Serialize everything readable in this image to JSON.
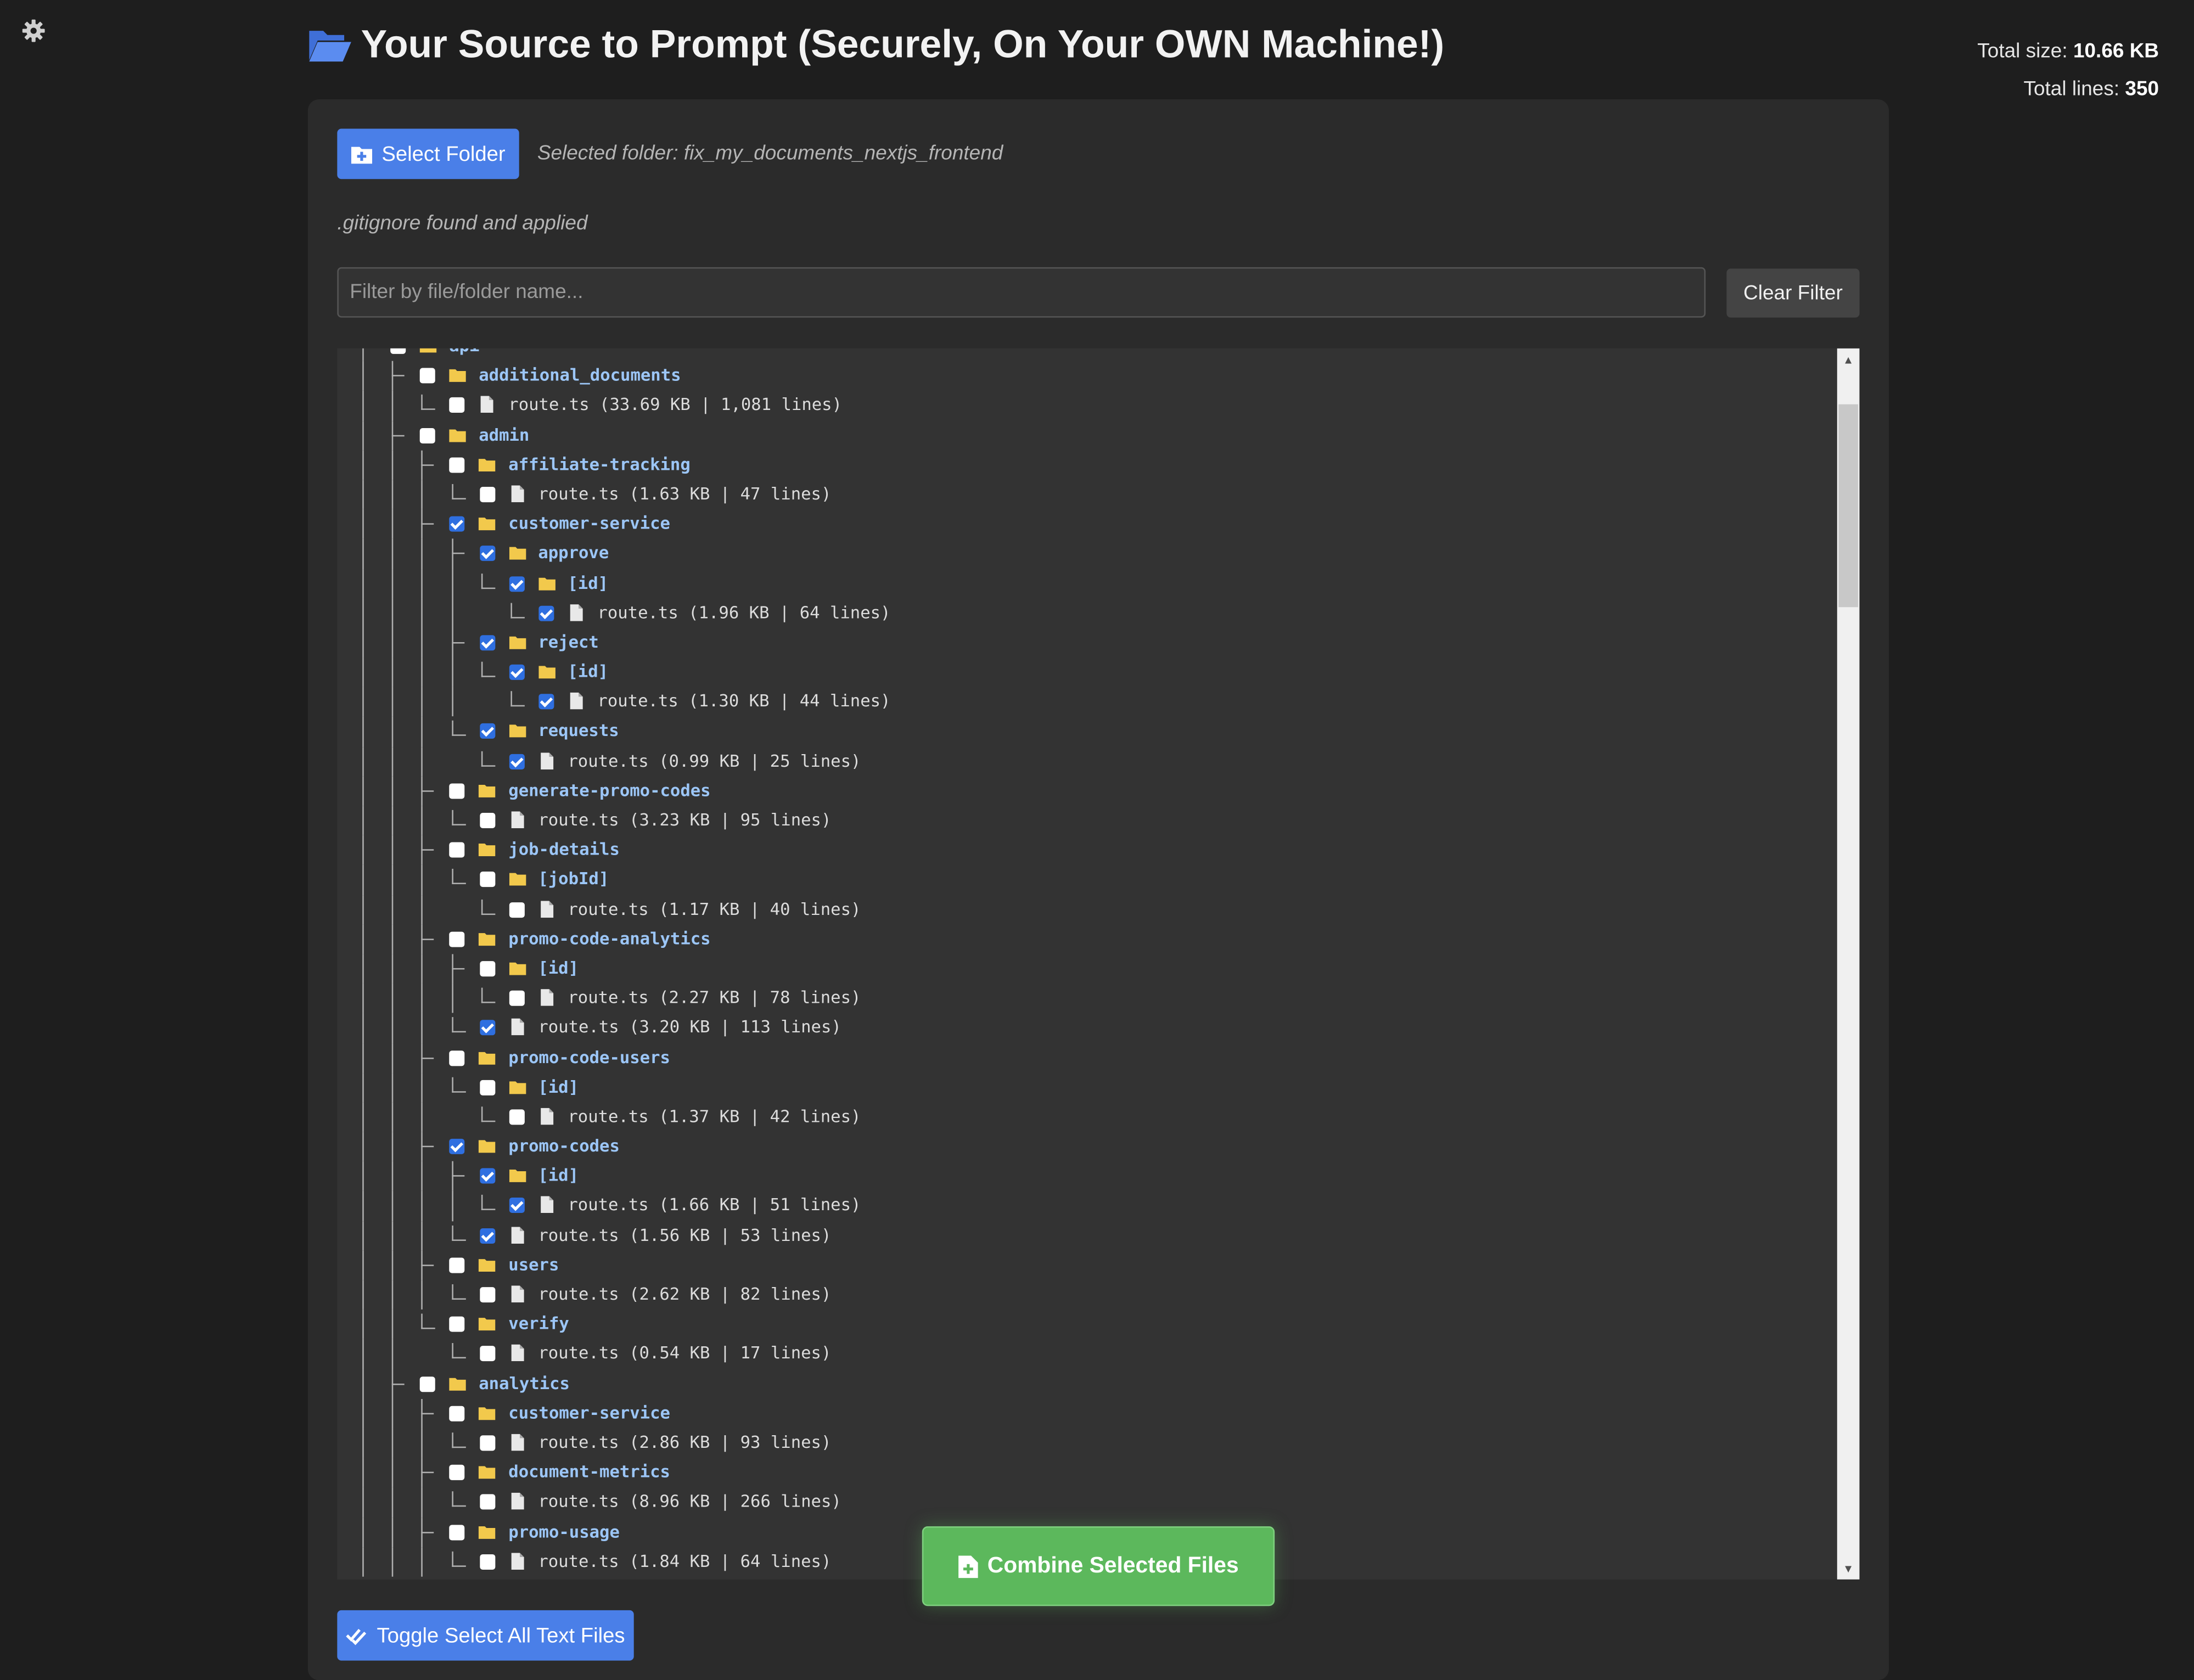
{
  "header": {
    "title": "Your Source to Prompt (Securely, On Your OWN Machine!)",
    "total_size_label": "Total size:",
    "total_size_value": "10.66 KB",
    "total_lines_label": "Total lines:",
    "total_lines_value": "350"
  },
  "toolbar": {
    "select_folder_label": "Select Folder",
    "selected_folder_text": "Selected folder: fix_my_documents_nextjs_frontend",
    "gitignore_text": ".gitignore found and applied",
    "filter_placeholder": "Filter by file/folder name...",
    "filter_value": "",
    "clear_filter_label": "Clear Filter"
  },
  "tree": {
    "rows": [
      {
        "depth": 1,
        "type": "folder",
        "name": "api",
        "checked": false,
        "last": false
      },
      {
        "depth": 2,
        "type": "folder",
        "name": "additional_documents",
        "checked": false,
        "last": false
      },
      {
        "depth": 3,
        "type": "file",
        "name": "route.ts (33.69 KB | 1,081 lines)",
        "checked": false,
        "last": true
      },
      {
        "depth": 2,
        "type": "folder",
        "name": "admin",
        "checked": false,
        "last": false
      },
      {
        "depth": 3,
        "type": "folder",
        "name": "affiliate-tracking",
        "checked": false,
        "last": false
      },
      {
        "depth": 4,
        "type": "file",
        "name": "route.ts (1.63 KB | 47 lines)",
        "checked": false,
        "last": true
      },
      {
        "depth": 3,
        "type": "folder",
        "name": "customer-service",
        "checked": true,
        "last": false
      },
      {
        "depth": 4,
        "type": "folder",
        "name": "approve",
        "checked": true,
        "last": false
      },
      {
        "depth": 5,
        "type": "folder",
        "name": "[id]",
        "checked": true,
        "last": true
      },
      {
        "depth": 6,
        "type": "file",
        "name": "route.ts (1.96 KB | 64 lines)",
        "checked": true,
        "last": true
      },
      {
        "depth": 4,
        "type": "folder",
        "name": "reject",
        "checked": true,
        "last": false
      },
      {
        "depth": 5,
        "type": "folder",
        "name": "[id]",
        "checked": true,
        "last": true
      },
      {
        "depth": 6,
        "type": "file",
        "name": "route.ts (1.30 KB | 44 lines)",
        "checked": true,
        "last": true
      },
      {
        "depth": 4,
        "type": "folder",
        "name": "requests",
        "checked": true,
        "last": true
      },
      {
        "depth": 5,
        "type": "file",
        "name": "route.ts (0.99 KB | 25 lines)",
        "checked": true,
        "last": true
      },
      {
        "depth": 3,
        "type": "folder",
        "name": "generate-promo-codes",
        "checked": false,
        "last": false
      },
      {
        "depth": 4,
        "type": "file",
        "name": "route.ts (3.23 KB | 95 lines)",
        "checked": false,
        "last": true
      },
      {
        "depth": 3,
        "type": "folder",
        "name": "job-details",
        "checked": false,
        "last": false
      },
      {
        "depth": 4,
        "type": "folder",
        "name": "[jobId]",
        "checked": false,
        "last": true
      },
      {
        "depth": 5,
        "type": "file",
        "name": "route.ts (1.17 KB | 40 lines)",
        "checked": false,
        "last": true
      },
      {
        "depth": 3,
        "type": "folder",
        "name": "promo-code-analytics",
        "checked": false,
        "last": false
      },
      {
        "depth": 4,
        "type": "folder",
        "name": "[id]",
        "checked": false,
        "last": false
      },
      {
        "depth": 5,
        "type": "file",
        "name": "route.ts (2.27 KB | 78 lines)",
        "checked": false,
        "last": true
      },
      {
        "depth": 4,
        "type": "file",
        "name": "route.ts (3.20 KB | 113 lines)",
        "checked": true,
        "last": true
      },
      {
        "depth": 3,
        "type": "folder",
        "name": "promo-code-users",
        "checked": false,
        "last": false
      },
      {
        "depth": 4,
        "type": "folder",
        "name": "[id]",
        "checked": false,
        "last": true
      },
      {
        "depth": 5,
        "type": "file",
        "name": "route.ts (1.37 KB | 42 lines)",
        "checked": false,
        "last": true
      },
      {
        "depth": 3,
        "type": "folder",
        "name": "promo-codes",
        "checked": true,
        "last": false
      },
      {
        "depth": 4,
        "type": "folder",
        "name": "[id]",
        "checked": true,
        "last": false
      },
      {
        "depth": 5,
        "type": "file",
        "name": "route.ts (1.66 KB | 51 lines)",
        "checked": true,
        "last": true
      },
      {
        "depth": 4,
        "type": "file",
        "name": "route.ts (1.56 KB | 53 lines)",
        "checked": true,
        "last": true
      },
      {
        "depth": 3,
        "type": "folder",
        "name": "users",
        "checked": false,
        "last": false
      },
      {
        "depth": 4,
        "type": "file",
        "name": "route.ts (2.62 KB | 82 lines)",
        "checked": false,
        "last": true
      },
      {
        "depth": 3,
        "type": "folder",
        "name": "verify",
        "checked": false,
        "last": true
      },
      {
        "depth": 4,
        "type": "file",
        "name": "route.ts (0.54 KB | 17 lines)",
        "checked": false,
        "last": true
      },
      {
        "depth": 2,
        "type": "folder",
        "name": "analytics",
        "checked": false,
        "last": false
      },
      {
        "depth": 3,
        "type": "folder",
        "name": "customer-service",
        "checked": false,
        "last": false
      },
      {
        "depth": 4,
        "type": "file",
        "name": "route.ts (2.86 KB | 93 lines)",
        "checked": false,
        "last": true
      },
      {
        "depth": 3,
        "type": "folder",
        "name": "document-metrics",
        "checked": false,
        "last": false
      },
      {
        "depth": 4,
        "type": "file",
        "name": "route.ts (8.96 KB | 266 lines)",
        "checked": false,
        "last": true
      },
      {
        "depth": 3,
        "type": "folder",
        "name": "promo-usage",
        "checked": false,
        "last": false
      },
      {
        "depth": 4,
        "type": "file",
        "name": "route.ts (1.84 KB | 64 lines)",
        "checked": false,
        "last": true
      }
    ]
  },
  "actions": {
    "toggle_select_label": "Toggle Select All Text Files",
    "combine_label": "Combine Selected Files"
  },
  "icons": {
    "settings": "gear-icon",
    "header": "folder-open-icon",
    "select_folder": "folder-plus-icon",
    "folder": "folder-icon",
    "file": "file-icon",
    "toggle": "check-double-icon",
    "combine": "file-plus-icon"
  },
  "colors": {
    "accent_blue": "#4a7fe8",
    "combine_green": "#5cb85c",
    "folder_yellow": "#f2c94c",
    "folder_label": "#9cc6f7",
    "background": "#1e1e1e",
    "panel": "#2b2b2b"
  }
}
